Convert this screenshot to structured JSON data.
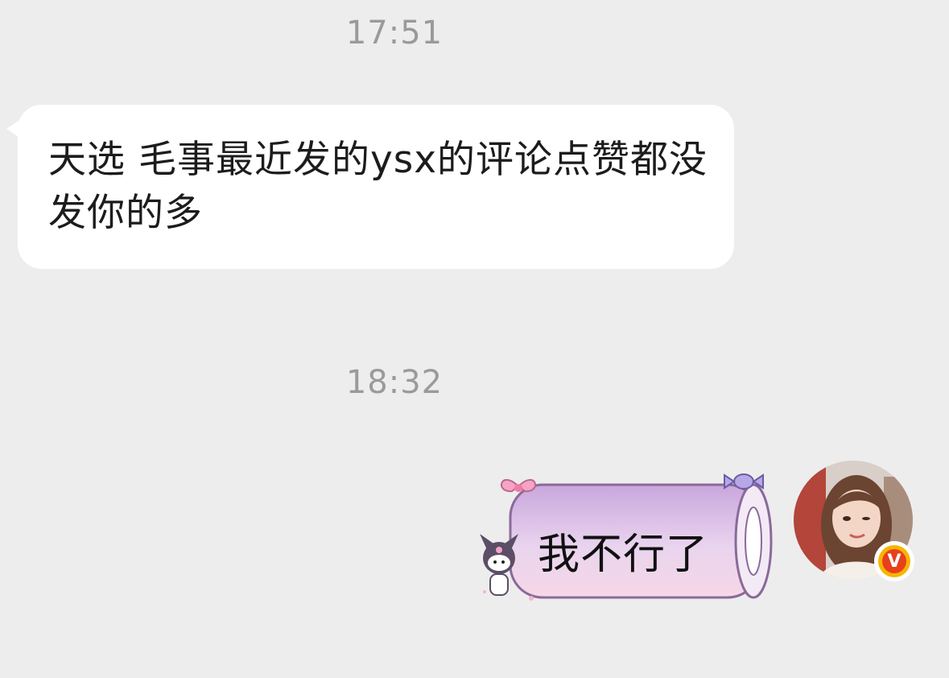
{
  "messages": [
    {
      "type": "timestamp",
      "text": "17:51"
    },
    {
      "type": "incoming",
      "text": "天选 毛事最近发的ysx的评论点赞都没发你的多"
    },
    {
      "type": "timestamp",
      "text": "18:32"
    },
    {
      "type": "outgoing",
      "text": "我不行了",
      "bubble_style": "kuromi-sticker-bubble"
    }
  ],
  "avatar": {
    "icon": "user-avatar-photo",
    "badge_text": "V",
    "badge_color": "#e8401c",
    "badge_ring": "#f7b500"
  },
  "colors": {
    "background": "#ededed",
    "incoming_bubble": "#ffffff",
    "outgoing_bubble": "#d9b8e6",
    "timestamp": "#9a9a9a"
  }
}
